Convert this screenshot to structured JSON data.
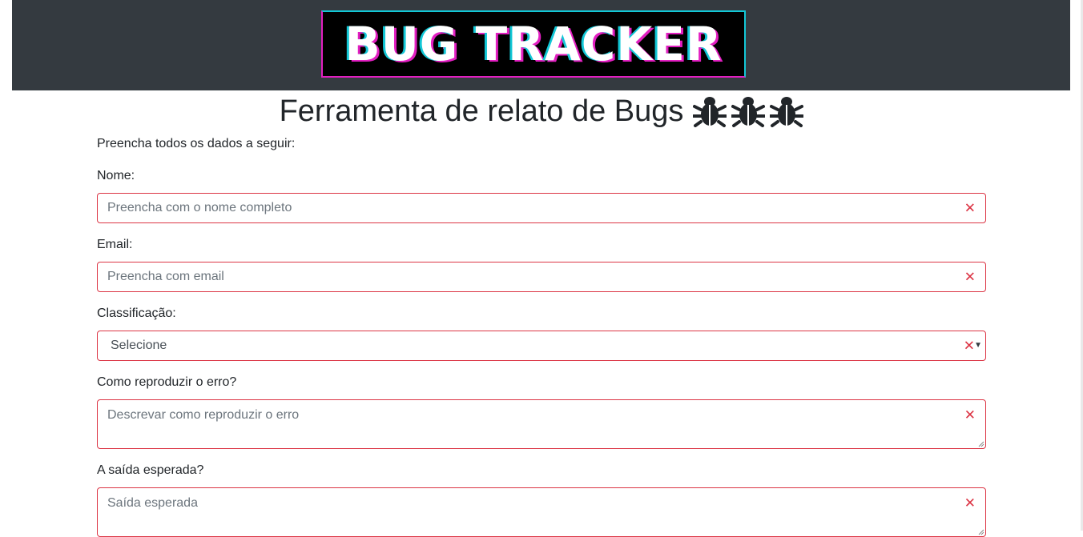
{
  "header": {
    "logo_text": "BUG TRACKER"
  },
  "title": {
    "text": "Ferramenta de relato de Bugs",
    "icons": [
      "bug-icon",
      "bug-icon",
      "bug-icon"
    ]
  },
  "form": {
    "intro": "Preencha todos os dados a seguir:",
    "fields": {
      "nome": {
        "label": "Nome:",
        "placeholder": "Preencha com o nome completo",
        "value": ""
      },
      "email": {
        "label": "Email:",
        "placeholder": "Preencha com email",
        "value": ""
      },
      "classificacao": {
        "label": "Classificação:",
        "selected": "Selecione"
      },
      "reproduzir": {
        "label": "Como reproduzir o erro?",
        "placeholder": "Descrevar como reproduzir o erro"
      },
      "saida": {
        "label": "A saída esperada?",
        "placeholder": "Saída esperada"
      }
    }
  },
  "colors": {
    "header_bg": "#343a40",
    "invalid": "#dc3545",
    "logo_cyan": "#12c7d6",
    "logo_magenta": "#e21fc1"
  }
}
